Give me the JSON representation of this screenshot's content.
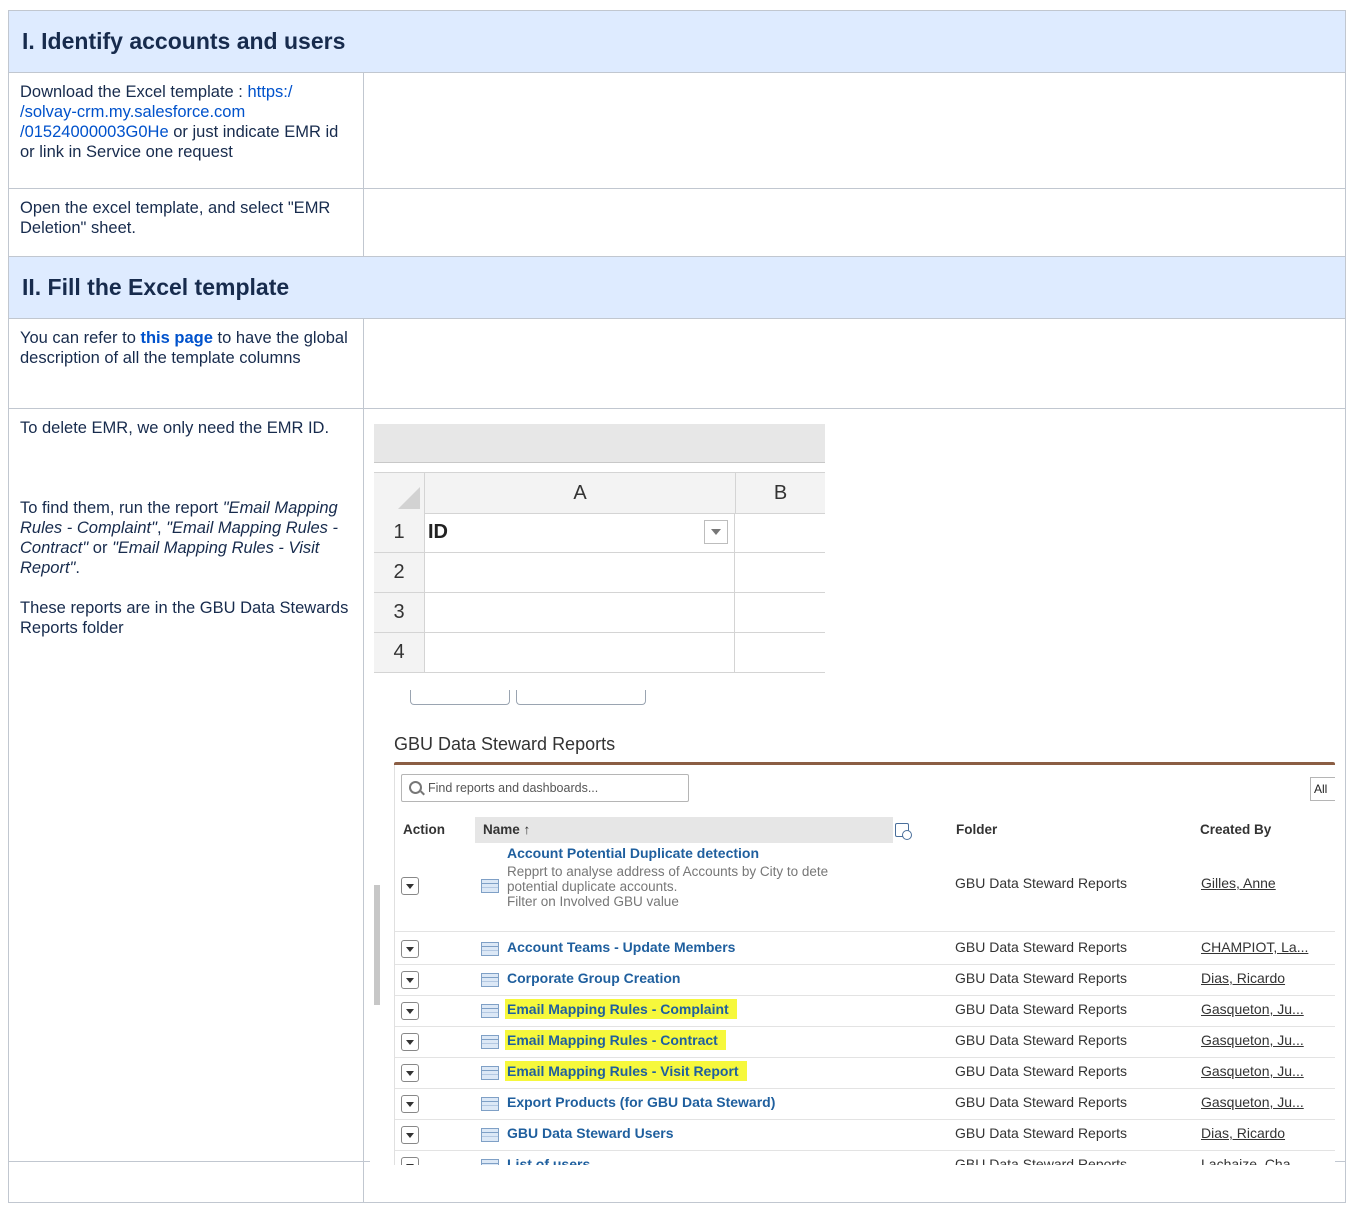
{
  "section1": {
    "title": "I. Identify accounts and users",
    "row1": {
      "pre": "Download the Excel template : ",
      "link": "https:/\n/solvay-crm.my.salesforce.com\n/01524000003G0He",
      "post": "  or just indicate EMR id or link in Service one request"
    },
    "row2": {
      "text": "Open the excel template, and select \"EMR Deletion\" sheet."
    }
  },
  "section2": {
    "title": "II. Fill the Excel template",
    "row1": {
      "pre": "You can refer to ",
      "link": "this page",
      "post": " to have the global description of all the template columns"
    },
    "row2": {
      "p1": "To delete EMR, we only need the EMR ID.",
      "p2_pre": "To find them, run the report ",
      "r1": "\"Email Mapping Rules - Complaint\"",
      "sep1": ", ",
      "r2": "\"Email Mapping Rules - Contract\"",
      "sep2": " or ",
      "r3": "\"Email Mapping Rules - Visit Report\"",
      "end": ".",
      "p3": "These reports are in the GBU Data Stewards Reports folder"
    }
  },
  "excel": {
    "columns": [
      "A",
      "B"
    ],
    "rows": [
      {
        "num": "1",
        "value": "ID"
      },
      {
        "num": "2",
        "value": ""
      },
      {
        "num": "3",
        "value": ""
      },
      {
        "num": "4",
        "value": ""
      }
    ]
  },
  "salesforce": {
    "folder_title": "GBU Data Steward Reports",
    "search_placeholder": "Find reports and dashboards...",
    "filter_label": "All",
    "headers": {
      "action": "Action",
      "name": "Name ↑",
      "folder": "Folder",
      "created_by": "Created By"
    },
    "reports": [
      {
        "name": "Account Potential Duplicate detection",
        "description": "Repprt to analyse address of Accounts by City to dete\npotential duplicate accounts.\nFilter on Involved GBU value",
        "folder": "GBU Data Steward Reports",
        "created_by": "Gilles, Anne",
        "highlight": false
      },
      {
        "name": "Account Teams - Update Members",
        "folder": "GBU Data Steward Reports",
        "created_by": "CHAMPIOT, La...",
        "highlight": false
      },
      {
        "name": "Corporate Group Creation",
        "folder": "GBU Data Steward Reports",
        "created_by": "Dias, Ricardo",
        "highlight": false
      },
      {
        "name": "Email Mapping Rules - Complaint",
        "folder": "GBU Data Steward Reports",
        "created_by": "Gasqueton, Ju...",
        "highlight": true
      },
      {
        "name": "Email Mapping Rules - Contract",
        "folder": "GBU Data Steward Reports",
        "created_by": "Gasqueton, Ju...",
        "highlight": true
      },
      {
        "name": "Email Mapping Rules - Visit Report",
        "folder": "GBU Data Steward Reports",
        "created_by": "Gasqueton, Ju...",
        "highlight": true
      },
      {
        "name": "Export Products (for GBU Data Steward)",
        "folder": "GBU Data Steward Reports",
        "created_by": "Gasqueton, Ju...",
        "highlight": false
      },
      {
        "name": "GBU Data Steward Users",
        "folder": "GBU Data Steward Reports",
        "created_by": "Dias, Ricardo",
        "highlight": false
      },
      {
        "name": "List of users",
        "folder": "GBU Data Steward Reports",
        "created_by": "Lachaize, Cha...",
        "highlight": false
      }
    ]
  },
  "colors": {
    "header_bg": "#deebff",
    "link": "#0052cc",
    "highlight": "#f6f83c",
    "report_link": "#1f5f9e"
  }
}
